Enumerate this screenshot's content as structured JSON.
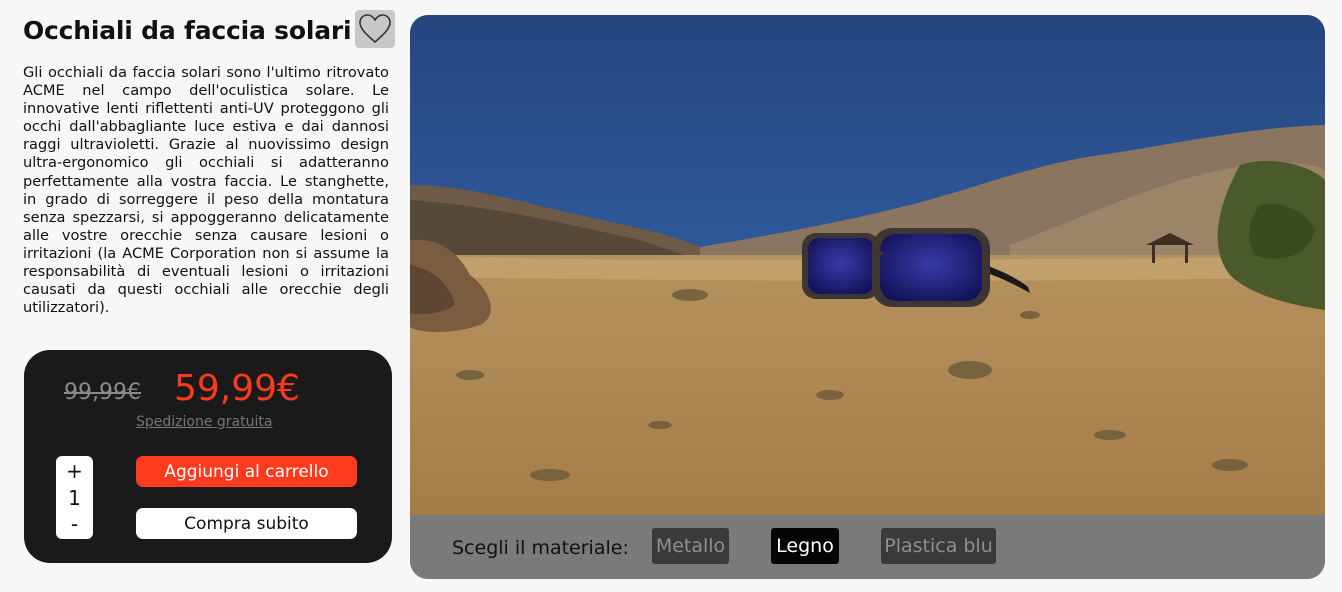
{
  "product": {
    "title": "Occhiali da faccia solari",
    "description": "Gli occhiali da faccia solari sono l'ultimo ritrovato ACME nel campo dell'oculistica solare. Le innovative lenti riflettenti anti-UV proteggono gli occhi dall'abbagliante luce estiva e dai dannosi raggi ultravioletti. Grazie al nuovissimo design ultra-ergonomico gli occhiali si adatteranno perfettamente alla vostra faccia. Le stanghette, in grado di sorreggere il peso della montatura senza spezzarsi, si appoggeranno delicatamente alle vostre orecchie senza causare lesioni o irritazioni (la ACME Corporation non si assume la responsabilità di eventuali lesioni o irritazioni causati da questi occhiali alle orecchie degli utilizzatori).",
    "favorite_icon": "heart-outline-icon"
  },
  "pricing": {
    "old_price": "99,99€",
    "new_price": "59,99€",
    "shipping": "Spedizione gratuita"
  },
  "quantity": {
    "increment": "+",
    "value": "1",
    "decrement": "-"
  },
  "actions": {
    "add_to_cart": "Aggiungi al carrello",
    "buy_now": "Compra subito"
  },
  "materials": {
    "label": "Scegli il materiale:",
    "options": [
      "Metallo",
      "Legno",
      "Plastica blu"
    ],
    "selected": "Legno"
  },
  "colors": {
    "accent": "#ff3b1f",
    "panel": "#1a1a1a",
    "material_bar": "#7a7a7a"
  }
}
